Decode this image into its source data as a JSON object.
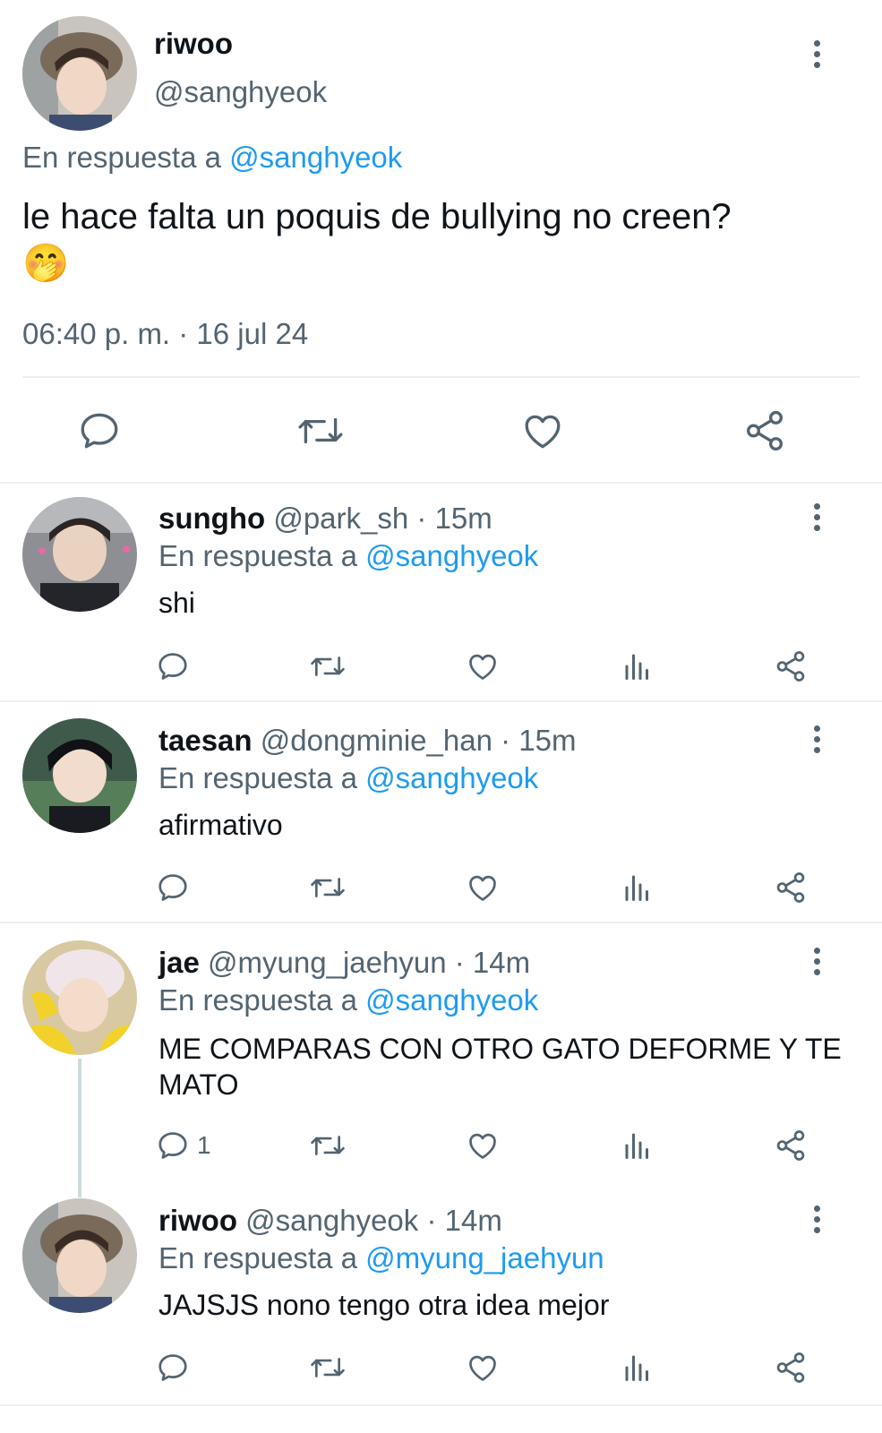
{
  "main_tweet": {
    "display_name": "riwoo",
    "handle": "@sanghyeok",
    "reply_prefix": "En respuesta a",
    "reply_to": "@sanghyeok",
    "text": "le hace falta un poquis de bullying no creen?",
    "emoji": "🤭",
    "timestamp": "06:40 p. m. · 16 jul 24"
  },
  "replies": [
    {
      "display_name": "sungho",
      "handle": "@park_sh",
      "time": "· 15m",
      "reply_prefix": "En respuesta a",
      "reply_to": "@sanghyeok",
      "text": "shi",
      "reply_count": ""
    },
    {
      "display_name": "taesan",
      "handle": "@dongminie_han",
      "time": "· 15m",
      "reply_prefix": "En respuesta a",
      "reply_to": "@sanghyeok",
      "text": "afirmativo",
      "reply_count": ""
    },
    {
      "display_name": "jae",
      "handle": "@myung_jaehyun",
      "time": "· 14m",
      "reply_prefix": "En respuesta a",
      "reply_to": "@sanghyeok",
      "text": "ME COMPARAS CON OTRO GATO DEFORME Y TE MATO",
      "reply_count": "1"
    },
    {
      "display_name": "riwoo",
      "handle": "@sanghyeok",
      "time": "· 14m",
      "reply_prefix": "En respuesta a",
      "reply_to": "@myung_jaehyun",
      "text": "JAJSJS nono tengo otra idea mejor",
      "reply_count": ""
    }
  ],
  "icons": [
    "reply-icon",
    "retweet-icon",
    "like-icon",
    "views-icon",
    "share-icon",
    "more-options-icon"
  ],
  "colors": {
    "link": "#1d9bf0",
    "muted": "#536471",
    "text": "#0f1419",
    "divider": "#eceef0"
  }
}
